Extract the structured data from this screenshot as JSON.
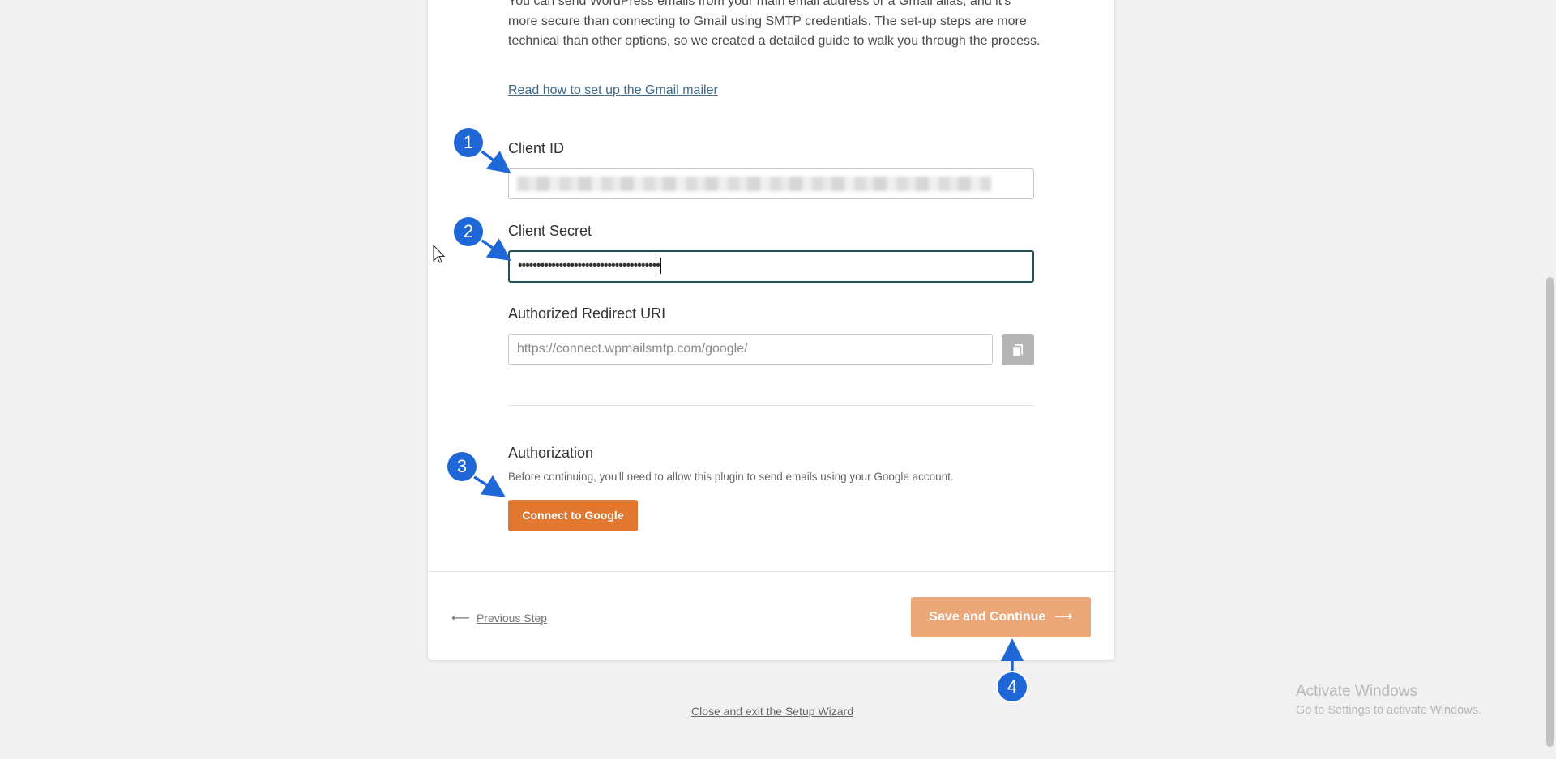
{
  "intro": {
    "text": "You can send WordPress emails from your main email address or a Gmail alias, and it's more secure than connecting to Gmail using SMTP credentials. The set-up steps are more technical than other options, so we created a detailed guide to walk you through the process.",
    "guide_link": "Read how to set up the Gmail mailer"
  },
  "fields": {
    "client_id_label": "Client ID",
    "client_secret_label": "Client Secret",
    "client_secret_value": "••••••••••••••••••••••••••••••••••••••",
    "redirect_label": "Authorized Redirect URI",
    "redirect_value": "https://connect.wpmailsmtp.com/google/"
  },
  "authorization": {
    "title": "Authorization",
    "description": "Before continuing, you'll need to allow this plugin to send emails using your Google account.",
    "connect_button": "Connect to Google"
  },
  "footer": {
    "previous_arrow": "⟵",
    "previous_step": "Previous Step",
    "save_continue": "Save and Continue",
    "save_arrow": "⟶",
    "close_wizard": "Close and exit the Setup Wizard"
  },
  "watermark": {
    "line1": "Activate Windows",
    "line2": "Go to Settings to activate Windows."
  },
  "annotations": [
    "1",
    "2",
    "3",
    "4"
  ],
  "colors": {
    "accent_orange": "#e27730",
    "disabled_orange": "#eca778",
    "annotation_blue": "#1f66d6",
    "focus_border": "#244f5a"
  },
  "icons": [
    "copy-icon",
    "arrow-left-icon",
    "arrow-right-icon",
    "mouse-cursor-icon"
  ]
}
